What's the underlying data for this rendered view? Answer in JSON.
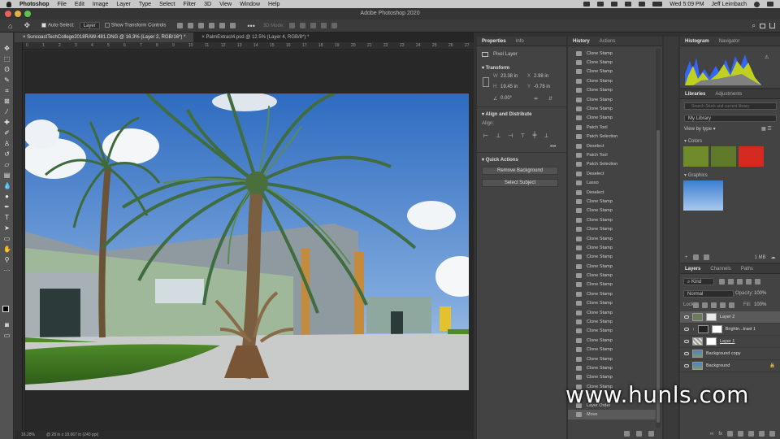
{
  "menubar": {
    "app": "Photoshop",
    "items": [
      "File",
      "Edit",
      "Image",
      "Layer",
      "Type",
      "Select",
      "Filter",
      "3D",
      "View",
      "Window",
      "Help"
    ],
    "datetime": "Wed 5:09 PM",
    "user": "Jeff Leimbach"
  },
  "window": {
    "title": "Adobe Photoshop 2020"
  },
  "options": {
    "auto_select_label": "Auto-Select:",
    "auto_select_value": "Layer",
    "transform_controls_label": "Show Transform Controls",
    "mode_3d": "3D Mode:"
  },
  "doc_tabs": [
    {
      "label": "SuncoastTechCollege2018RAW-481.DNG @ 16.3% (Layer 2, RGB/16*) *"
    },
    {
      "label": "PalmExtract4.psd @ 12.5% (Layer 4, RGB/8*) *"
    }
  ],
  "ruler": [
    "0",
    "1",
    "2",
    "3",
    "4",
    "5",
    "6",
    "7",
    "8",
    "9",
    "10",
    "11",
    "12",
    "13",
    "14",
    "15",
    "16",
    "17",
    "18",
    "19",
    "20",
    "21",
    "22",
    "23",
    "24",
    "25",
    "26",
    "27"
  ],
  "status": {
    "zoom": "16.28%",
    "doc_size": "@ 28 in x 18.667 in (240 ppi)"
  },
  "properties": {
    "tabs": [
      "Properties",
      "Info"
    ],
    "layer_kind": "Pixel Layer",
    "transform_title": "Transform",
    "w_label": "W",
    "w": "23.38 in",
    "x_label": "X",
    "x": "2.98 in",
    "h_label": "H",
    "h": "19.45 in",
    "y_label": "Y",
    "y": "-0.78 in",
    "angle": "0.00°",
    "align_title": "Align and Distribute",
    "align_label": "Align:",
    "quick_title": "Quick Actions",
    "remove_bg": "Remove Background",
    "select_subject": "Select Subject"
  },
  "history": {
    "tabs": [
      "History",
      "Actions"
    ],
    "items": [
      "Clone Stamp",
      "Clone Stamp",
      "Clone Stamp",
      "Clone Stamp",
      "Clone Stamp",
      "Clone Stamp",
      "Clone Stamp",
      "Clone Stamp",
      "Patch Tool",
      "Patch Selection",
      "Deselect",
      "Patch Tool",
      "Patch Selection",
      "Deselect",
      "Lasso",
      "Deselect",
      "Clone Stamp",
      "Clone Stamp",
      "Clone Stamp",
      "Clone Stamp",
      "Clone Stamp",
      "Clone Stamp",
      "Clone Stamp",
      "Clone Stamp",
      "Clone Stamp",
      "Clone Stamp",
      "Clone Stamp",
      "Clone Stamp",
      "Clone Stamp",
      "Clone Stamp",
      "Clone Stamp",
      "Clone Stamp",
      "Clone Stamp",
      "Clone Stamp",
      "Clone Stamp",
      "Clone Stamp",
      "Clone Stamp",
      "Move",
      "Layer Order",
      "Move"
    ]
  },
  "histogram": {
    "tabs": [
      "Histogram",
      "Navigator"
    ]
  },
  "libraries": {
    "tabs": [
      "Libraries",
      "Adjustments"
    ],
    "search_placeholder": "Search Stock and current library",
    "library": "My Library",
    "view_by": "View by type",
    "colors_title": "Colors",
    "colors": [
      "#6f8b2c",
      "#5e7a2a",
      "#d42a1f"
    ],
    "graphics_title": "Graphics",
    "size": "1 MB"
  },
  "layers": {
    "tabs": [
      "Layers",
      "Channels",
      "Paths"
    ],
    "kind": "Kind",
    "blend": "Normal",
    "opacity_label": "Opacity:",
    "opacity": "100%",
    "lock_label": "Lock:",
    "fill_label": "Fill:",
    "fill": "100%",
    "items": [
      "Layer 2",
      "Brightn...trast 1",
      "Layer 1",
      "Background copy",
      "Background"
    ]
  },
  "watermark": "www.hunls.com"
}
